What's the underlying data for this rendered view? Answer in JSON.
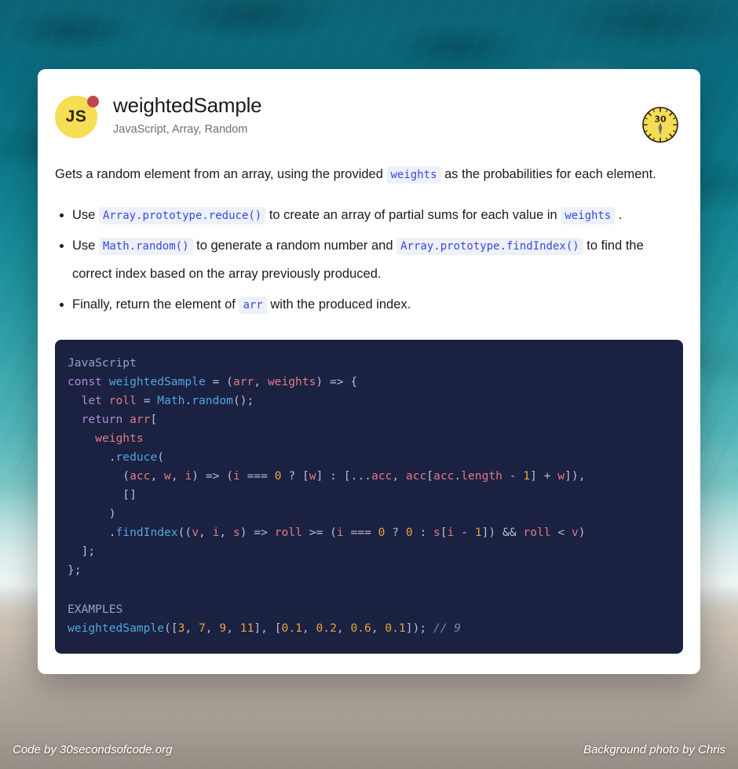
{
  "card": {
    "avatar": {
      "label": "JS",
      "color": "#f5dd54",
      "dot_color": "#c0474e"
    },
    "title": "weightedSample",
    "tags": "JavaScript, Array, Random",
    "badge": {
      "value": "30",
      "color": "#f5dd54",
      "name": "thirty-second-clock"
    },
    "description": {
      "before": "Gets a random element from an array, using the provided",
      "code": "weights",
      "after": "as the probabilities for each element."
    },
    "steps": [
      {
        "parts": [
          {
            "type": "text",
            "value": "Use"
          },
          {
            "type": "code",
            "value": "Array.prototype.reduce()"
          },
          {
            "type": "text",
            "value": "to create an array of partial sums for each value in"
          },
          {
            "type": "code",
            "value": "weights"
          },
          {
            "type": "text",
            "value": "."
          }
        ]
      },
      {
        "parts": [
          {
            "type": "text",
            "value": "Use"
          },
          {
            "type": "code",
            "value": "Math.random()"
          },
          {
            "type": "text",
            "value": "to generate a random number and"
          },
          {
            "type": "code",
            "value": "Array.prototype.findIndex()"
          },
          {
            "type": "text",
            "value": "to find the correct index based on the array previously produced."
          }
        ]
      },
      {
        "parts": [
          {
            "type": "text",
            "value": "Finally, return the element of"
          },
          {
            "type": "code",
            "value": "arr"
          },
          {
            "type": "text",
            "value": "with the produced index."
          }
        ]
      }
    ],
    "code": {
      "language_label": "JavaScript",
      "examples_label": "EXAMPLES",
      "source": "const weightedSample = (arr, weights) => {\n  let roll = Math.random();\n  return arr[\n    weights\n      .reduce(\n        (acc, w, i) => (i === 0 ? [w] : [...acc, acc[acc.length - 1] + w]),\n        []\n      )\n      .findIndex((v, i, s) => roll >= (i === 0 ? 0 : s[i - 1]) && roll < v)\n  ];\n};",
      "example_source": "weightedSample([3, 7, 9, 11], [0.1, 0.2, 0.6, 0.1]); // 9",
      "colors": {
        "background": "#1b2141",
        "keyword": "#a98fd4",
        "function": "#4fa6e0",
        "variable": "#e07a84",
        "number": "#e8a33d",
        "punctuation": "#b9bed6",
        "comment": "#7f86a3",
        "label": "#9aa0bd"
      }
    }
  },
  "footer": {
    "left": "Code by 30secondsofcode.org",
    "right": "Background photo by Chris"
  }
}
